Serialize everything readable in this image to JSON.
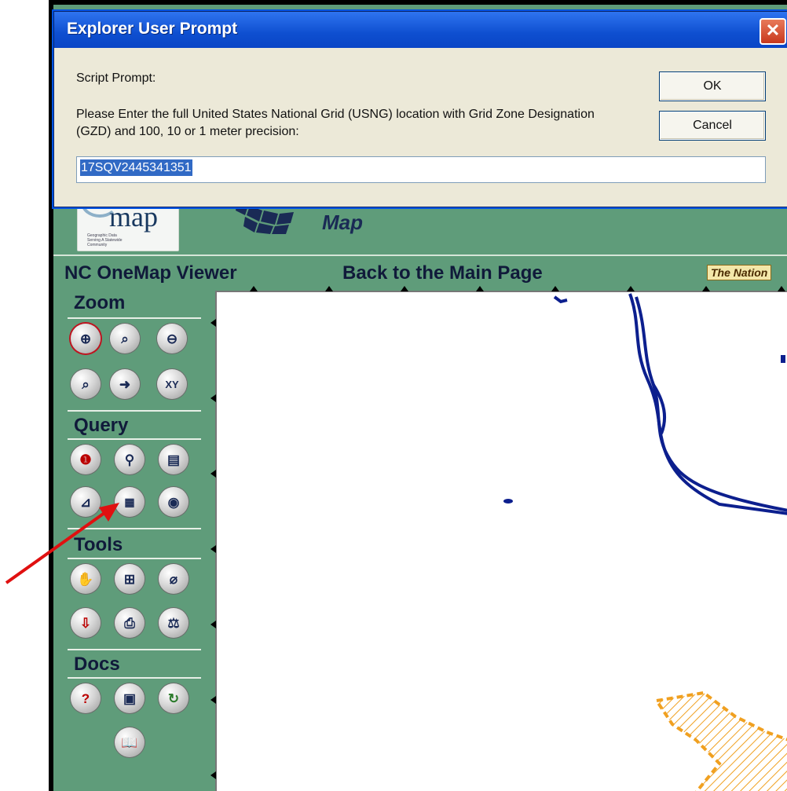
{
  "dialog": {
    "title": "Explorer User Prompt",
    "close_glyph": "✕",
    "label": "Script Prompt:",
    "message": "Please Enter the full United States National Grid (USNG) location with Grid Zone Designation (GZD) and 100, 10 or 1 meter precision:",
    "ok_label": "OK",
    "cancel_label": "Cancel",
    "input_value": "17SQV2445341351"
  },
  "header": {
    "logo_word": "map",
    "logo_tagline": "Geographic Data Serving A Statewide Community",
    "map_word": "Map"
  },
  "nav": {
    "viewer": "NC OneMap Viewer",
    "back": "Back to the Main Page",
    "national": "The Nation"
  },
  "toolbar": {
    "zoom": "Zoom",
    "query": "Query",
    "tools": "Tools",
    "docs": "Docs"
  },
  "icons": {
    "zoom_in": "zoom-in-icon",
    "zoom_area": "zoom-area-icon",
    "zoom_out": "zoom-out-icon",
    "zoom_previous": "zoom-previous-icon",
    "pan_arrow": "arrow-pan-icon",
    "xy": "xy-coordinate-icon",
    "identify": "info-icon",
    "find": "binoculars-icon",
    "query_layer": "query-layer-icon",
    "measure": "measure-icon",
    "xy_query": "xy-grid-icon",
    "buffer": "buffer-icon",
    "pan_hand": "hand-icon",
    "legend": "legend-icon",
    "clear": "eraser-icon",
    "download": "download-icon",
    "print": "printer-icon",
    "scale": "scale-icon",
    "help": "help-icon",
    "metadata": "metadata-icon",
    "refresh": "refresh-icon",
    "book": "book-icon"
  },
  "colors": {
    "app_green": "#5f9c7a",
    "river_blue": "#0c1f8e",
    "boundary_orange": "#f0a020",
    "annotation_red": "#e01010"
  }
}
